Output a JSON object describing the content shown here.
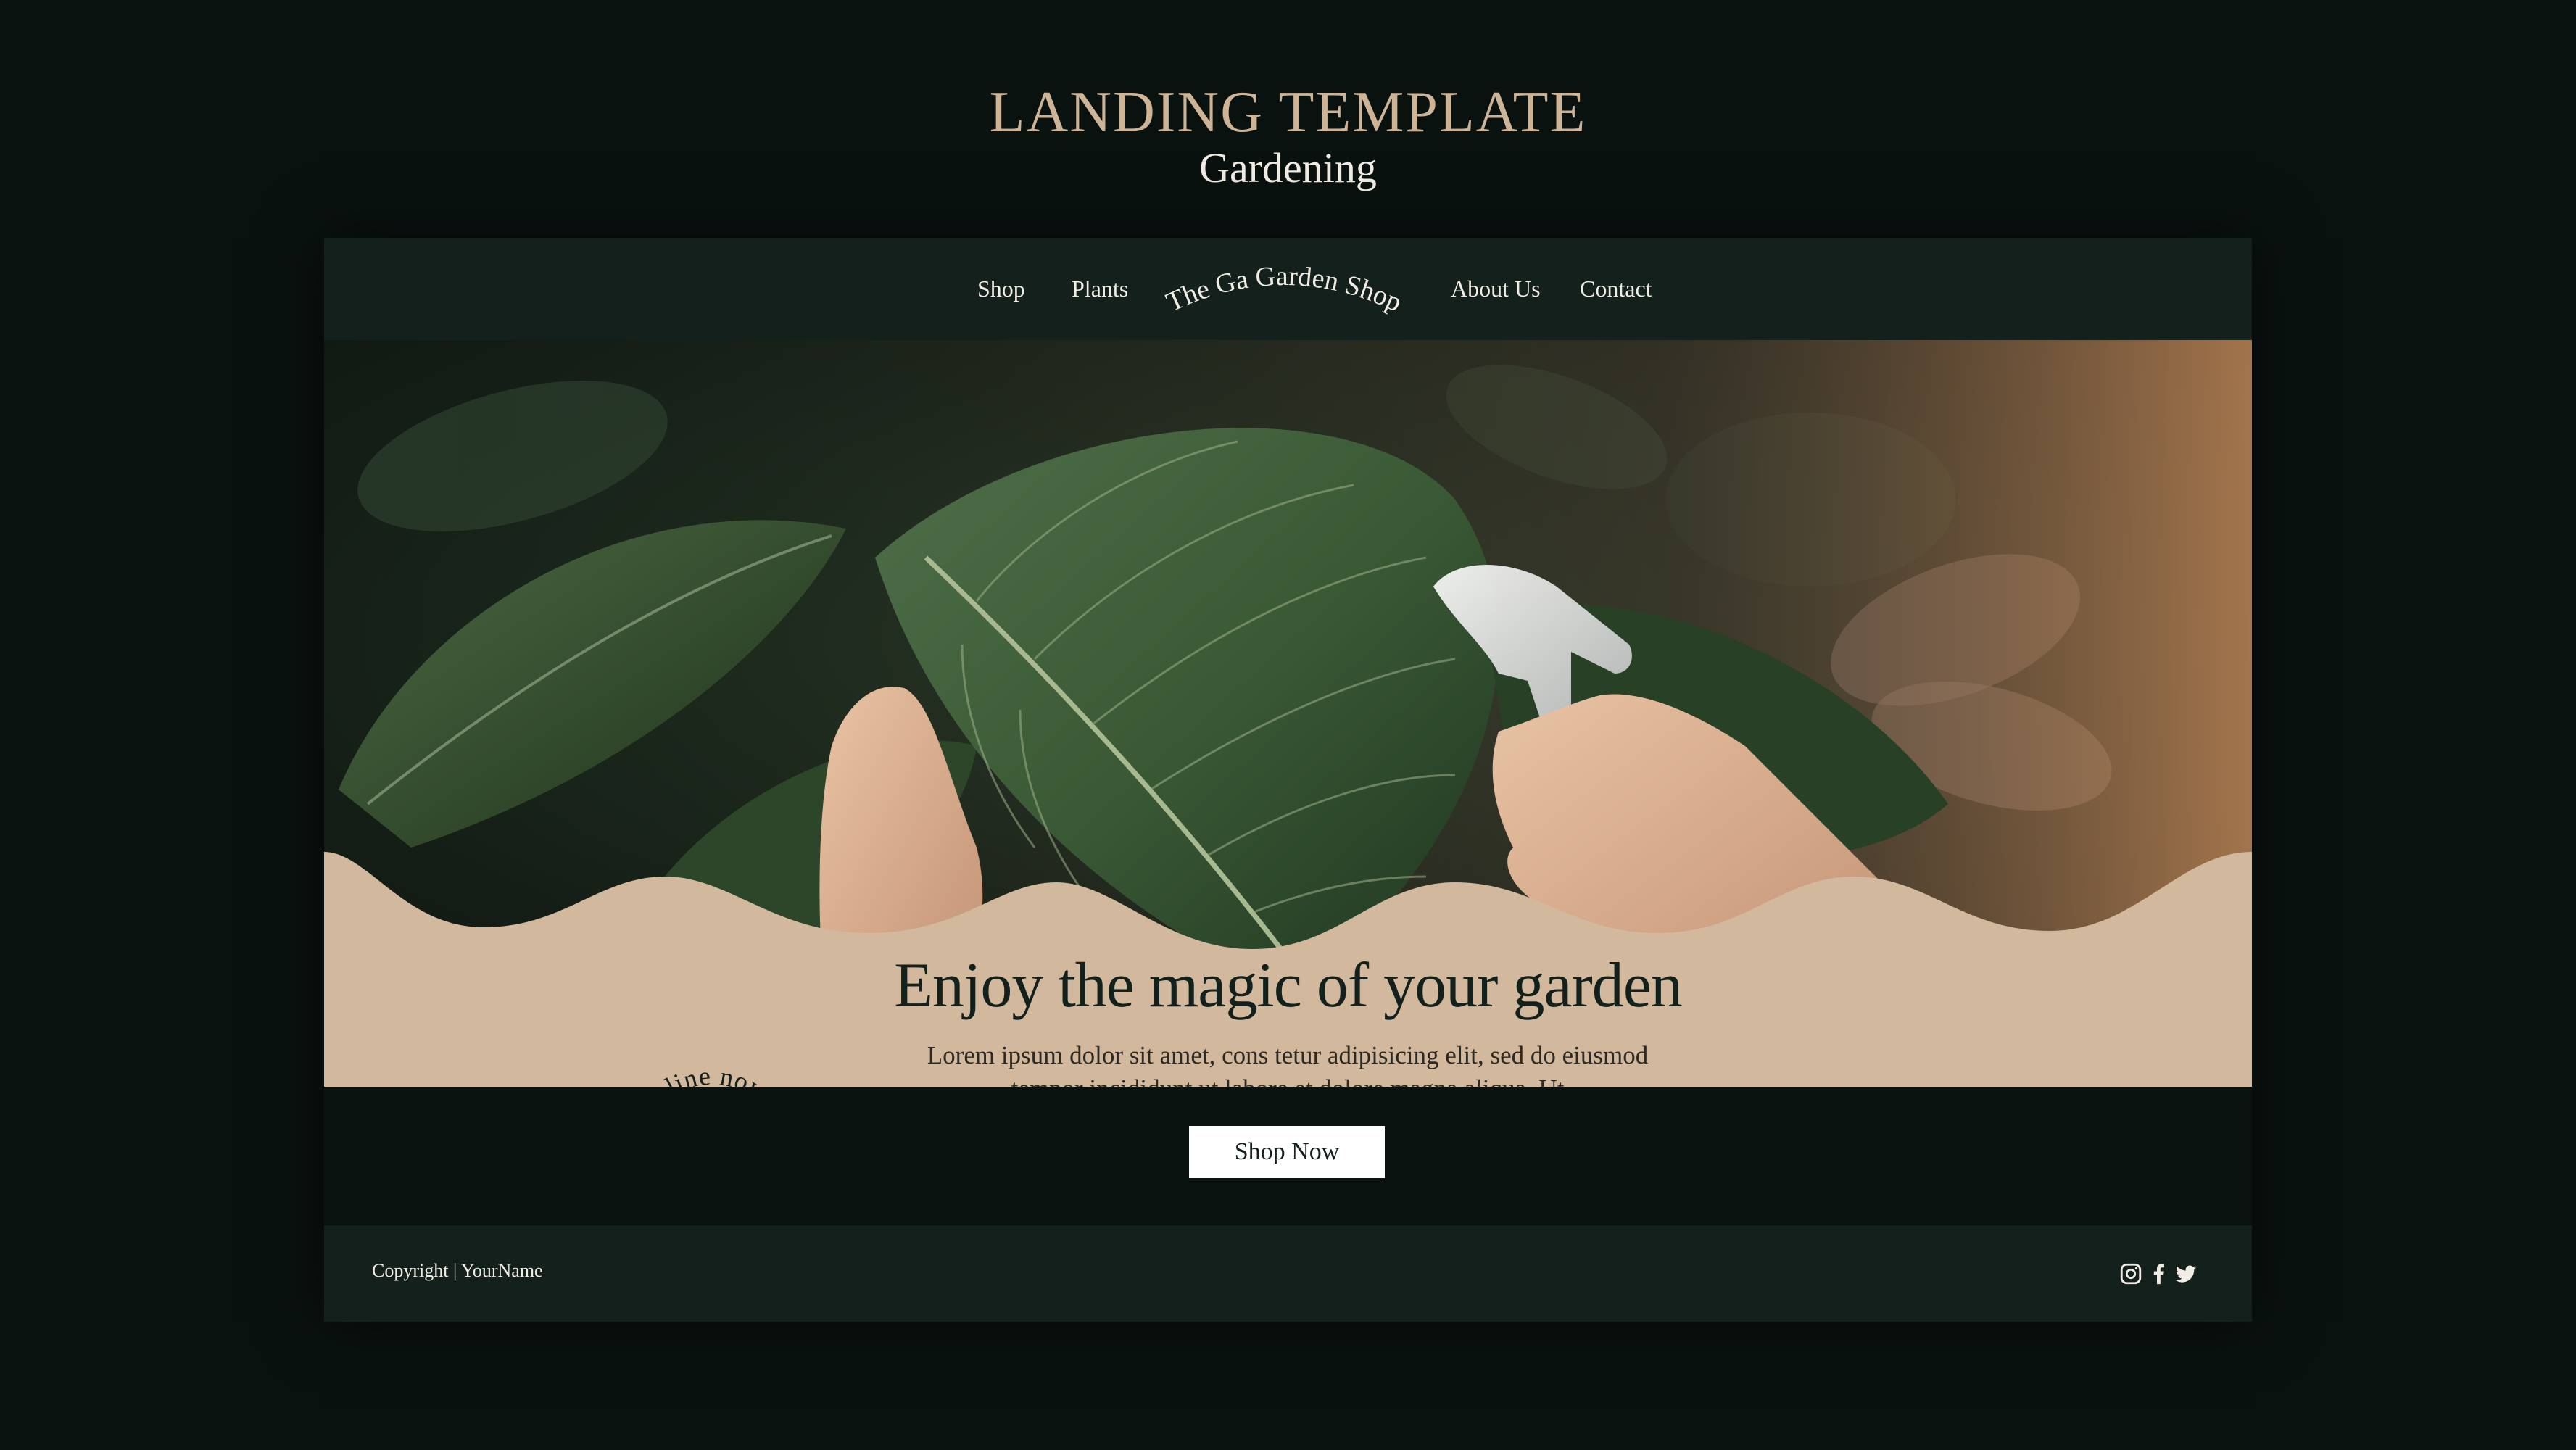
{
  "header": {
    "title": "LANDING TEMPLATE",
    "subtitle": "Gardening"
  },
  "nav": {
    "items": [
      {
        "label": "Shop"
      },
      {
        "label": "Plants"
      },
      {
        "label": "About Us"
      },
      {
        "label": "Contact"
      }
    ],
    "logo_text": "The Ga Garden Shop"
  },
  "hero": {
    "headline": "Enjoy the magic of your garden",
    "body": "Lorem ipsum dolor sit amet, cons tetur adipisicing elit, sed do eiusmod tempor incididunt ut labore et dolore magna aliqua. Ut",
    "button_label": "Shop Now",
    "badge_text": "Buy online now · Buy online now ·"
  },
  "footer": {
    "copyright": "Copyright | YourName",
    "social_icons": [
      "instagram-icon",
      "facebook-icon",
      "twitter-icon"
    ]
  },
  "colors": {
    "background": "#0a1210",
    "nav": "#13201c",
    "beige": "#d2b89c",
    "title_gold": "#cdb497",
    "text_light": "#f2ede4"
  }
}
